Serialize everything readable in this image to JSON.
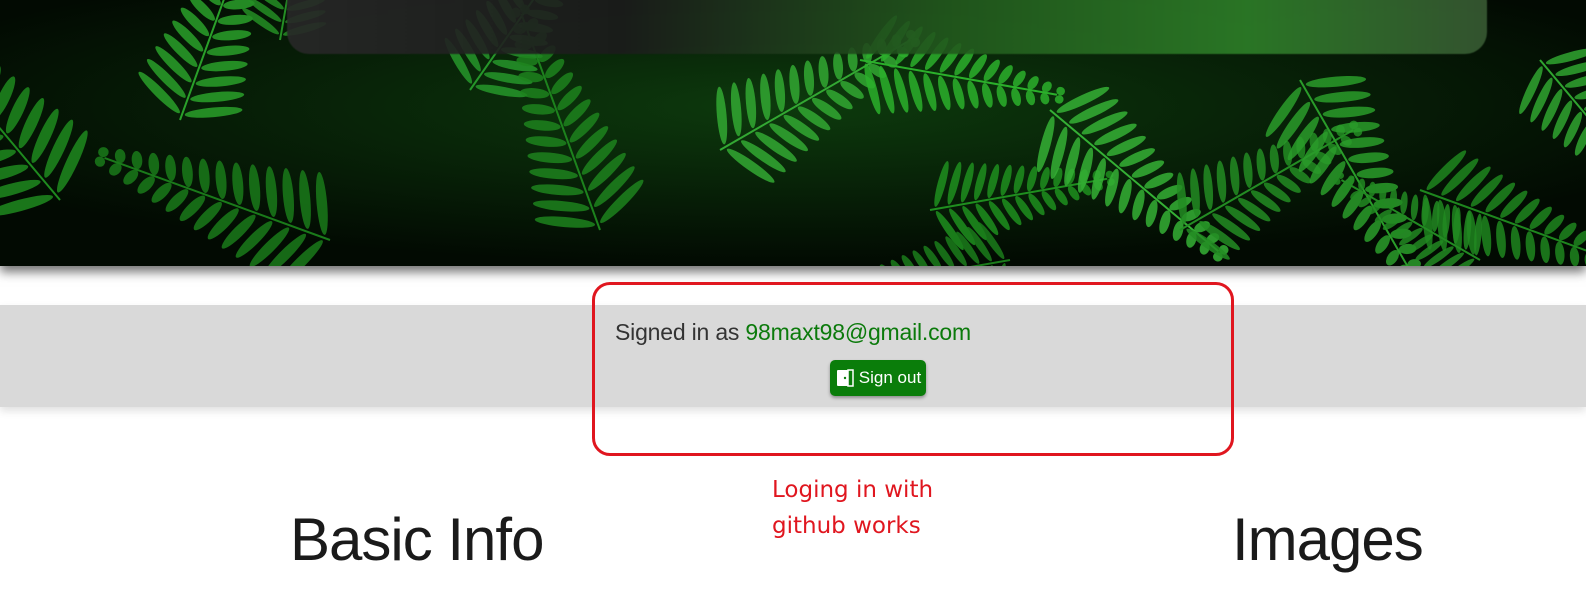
{
  "auth": {
    "signed_in_prefix": "Signed in as ",
    "email": "98maxt98@gmail.com",
    "signout_label": "Sign out",
    "signout_icon": "door-exit-icon"
  },
  "annotation": {
    "text": "Loging in with\ngithub works",
    "color": "#e0161f"
  },
  "sections": {
    "basic_info": "Basic Info",
    "images": "Images"
  },
  "colors": {
    "brand_green": "#0a7d0a",
    "email_green": "#0b7a0b",
    "band_gray": "#d9d9d9"
  }
}
